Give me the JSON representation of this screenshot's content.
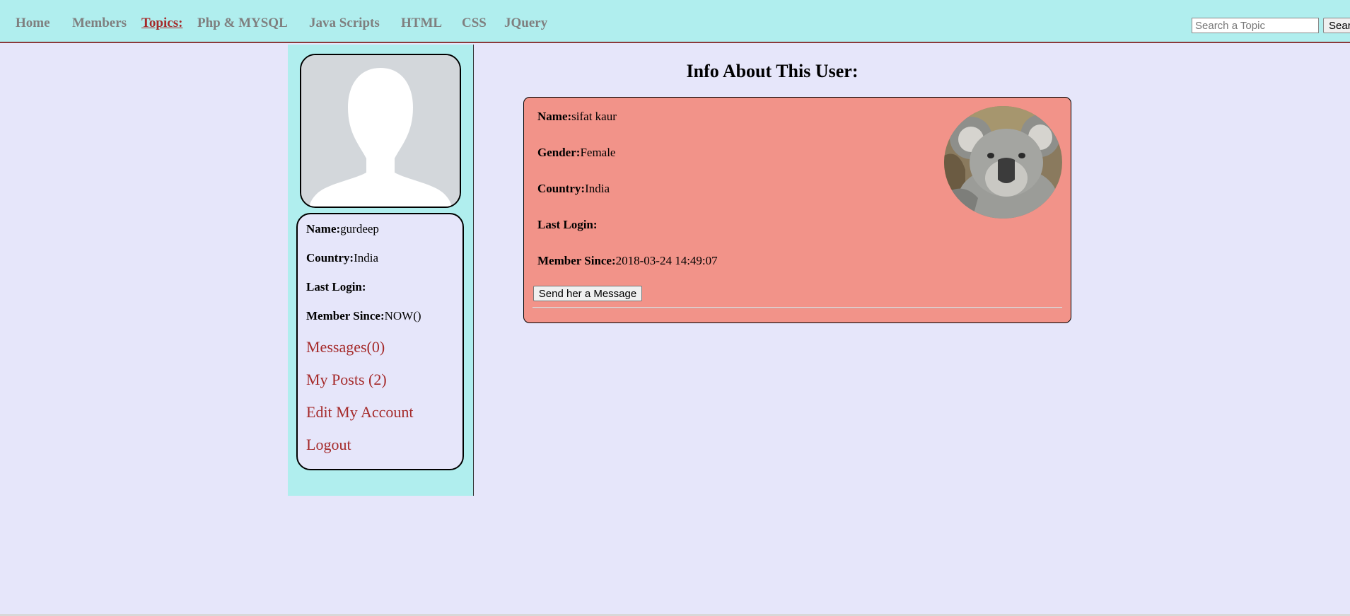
{
  "nav": {
    "home": "Home",
    "members": "Members",
    "topics": "Topics:",
    "php": "Php & MYSQL",
    "javascripts": "Java Scripts",
    "html": "HTML",
    "css": "CSS",
    "jquery": "JQuery"
  },
  "search": {
    "placeholder": "Search a Topic",
    "button": "Search"
  },
  "sidebar": {
    "name_label": "Name:",
    "name_value": "gurdeep",
    "country_label": "Country:",
    "country_value": "India",
    "last_login_label": "Last Login:",
    "last_login_value": "",
    "member_since_label": "Member Since:",
    "member_since_value": "NOW()",
    "links": {
      "messages": "Messages(0)",
      "my_posts": "My Posts (2)",
      "edit_account": "Edit My Account",
      "logout": "Logout"
    }
  },
  "main": {
    "title": "Info About This User:",
    "profile": {
      "name_label": "Name:",
      "name_value": "sifat kaur",
      "gender_label": "Gender:",
      "gender_value": "Female",
      "country_label": "Country:",
      "country_value": "India",
      "last_login_label": "Last Login:",
      "last_login_value": "",
      "member_since_label": "Member Since:",
      "member_since_value": "2018-03-24 14:49:07",
      "message_button": "Send her a Message"
    }
  },
  "colors": {
    "nav_bg": "#b0eeee",
    "page_bg": "#e6e6fa",
    "card_bg": "#f29389",
    "link": "#a52a2a",
    "nav_text": "#7f7f7f"
  }
}
